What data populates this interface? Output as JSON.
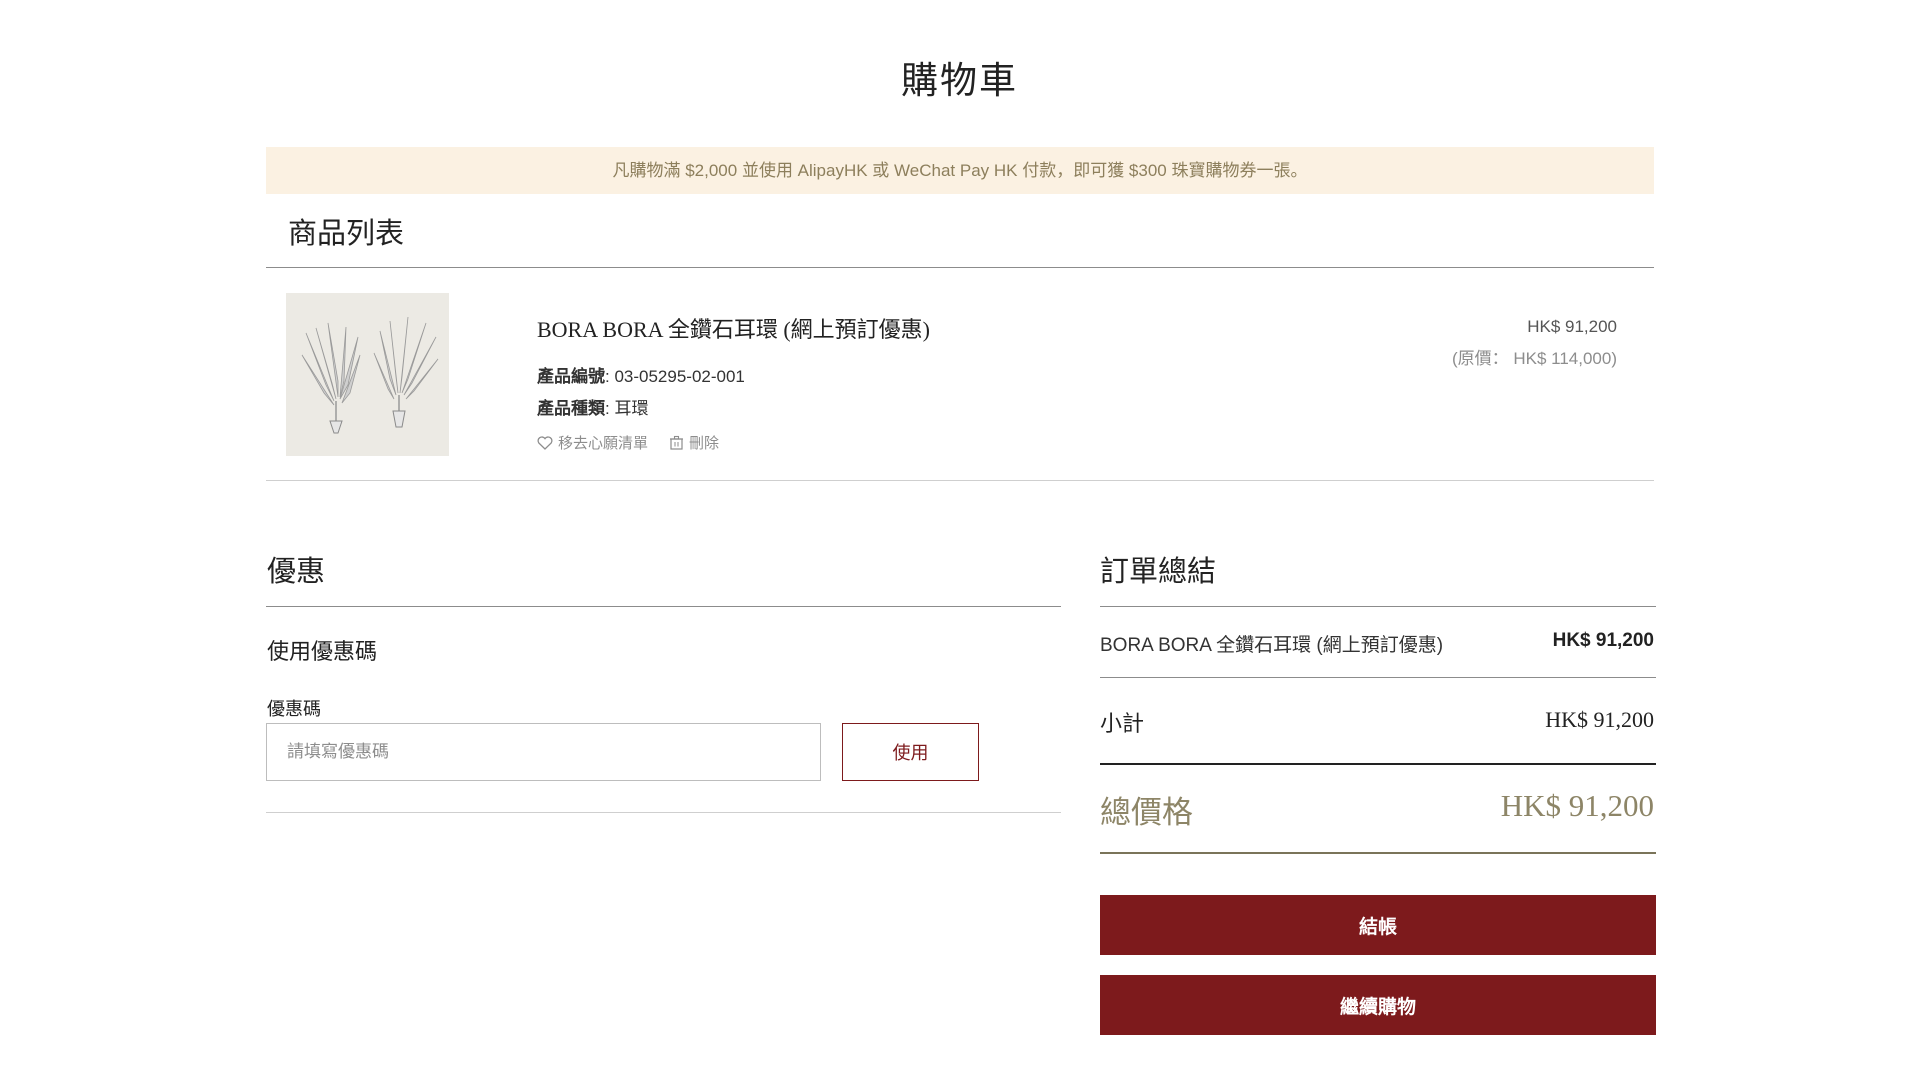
{
  "page": {
    "title": "購物車"
  },
  "promo_banner": {
    "text": "凡購物滿 $2,000 並使用 AlipayHK 或 WeChat Pay HK 付款，即可獲 $300 珠寶購物券一張。"
  },
  "products_section": {
    "title": "商品列表",
    "items": [
      {
        "name": "BORA BORA 全鑽石耳環 (網上預訂優惠)",
        "code_label": "產品編號",
        "code_value": ": 03-05295-02-001",
        "type_label": "產品種類",
        "type_value": ": 耳環",
        "wishlist_label": "移去心願清單",
        "delete_label": "刪除",
        "price": "HK$ 91,200",
        "original_price": "(原價： HK$ 114,000)",
        "image_icon": "diamond-earrings-image"
      }
    ]
  },
  "coupon": {
    "title": "優惠",
    "subtitle": "使用優惠碼",
    "field_label": "優惠碼",
    "placeholder": "請填寫優惠碼",
    "value": "",
    "apply_label": "使用"
  },
  "summary": {
    "title": "訂單總結",
    "item_name": "BORA BORA 全鑽石耳環 (網上預訂優惠)",
    "item_price": "HK$ 91,200",
    "subtotal_label": "小計",
    "subtotal_value": "HK$ 91,200",
    "total_label": "總價格",
    "total_value": "HK$ 91,200",
    "checkout_label": "結帳",
    "continue_label": "繼續購物"
  },
  "colors": {
    "accent": "#7d1a1c",
    "banner_bg": "#fbf1e2",
    "banner_text": "#8d7f5c",
    "total_text": "#8d8567"
  }
}
